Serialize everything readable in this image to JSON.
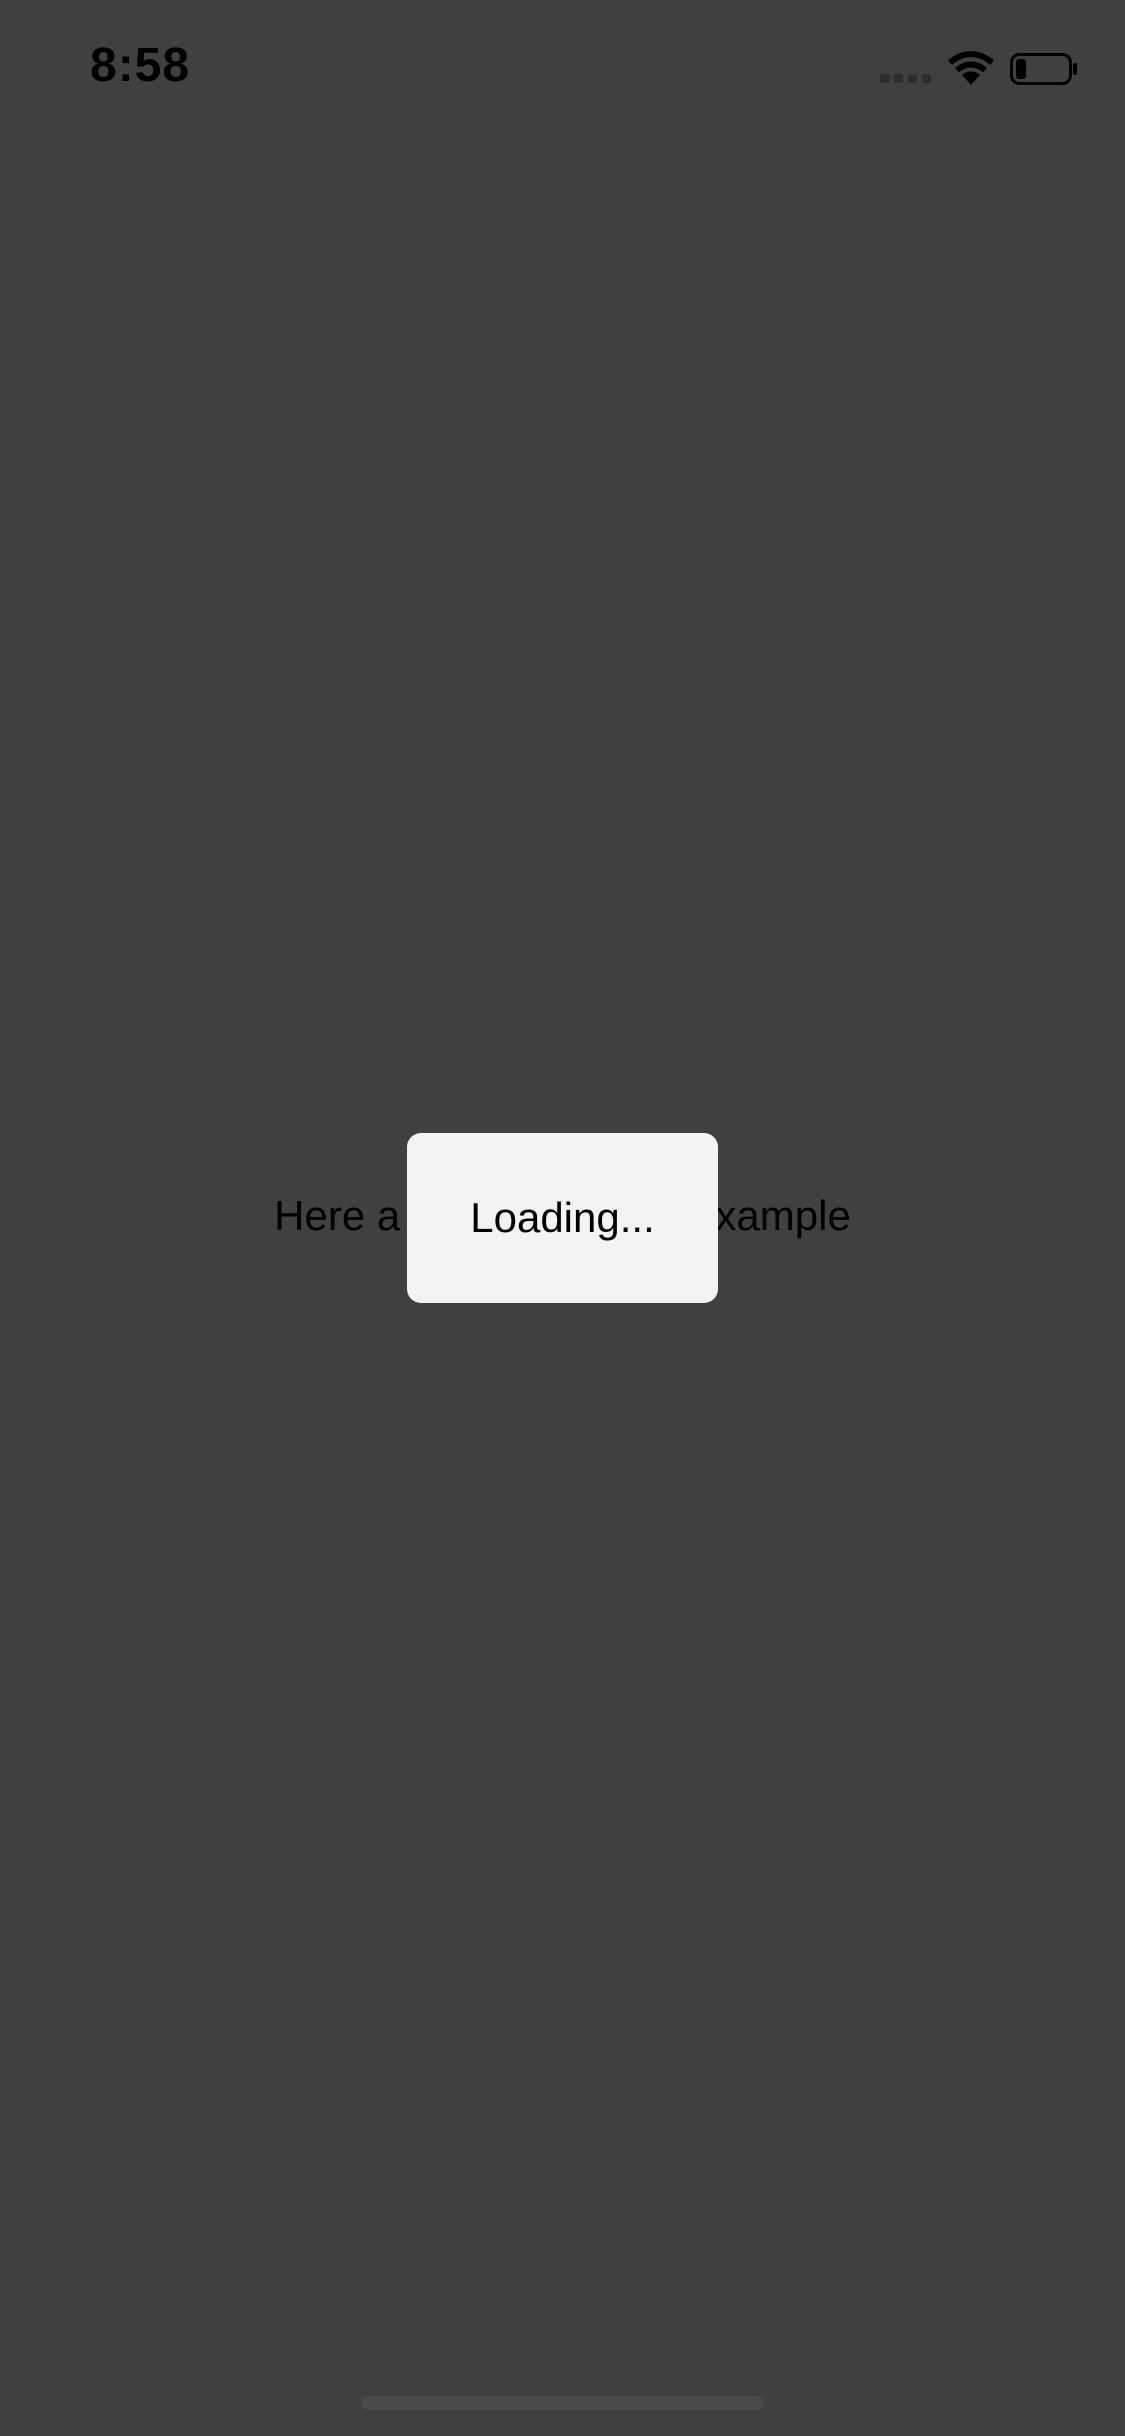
{
  "status_bar": {
    "time": "8:58",
    "icons": [
      "cellular-signal-icon",
      "wifi-icon",
      "battery-icon"
    ],
    "battery_level": 0.2
  },
  "main": {
    "message": "Here a simple loading example"
  },
  "loading_dialog": {
    "text": "Loading..."
  },
  "colors": {
    "background": "#404040",
    "dialog": "#f3f3f3",
    "text": "#000000"
  }
}
